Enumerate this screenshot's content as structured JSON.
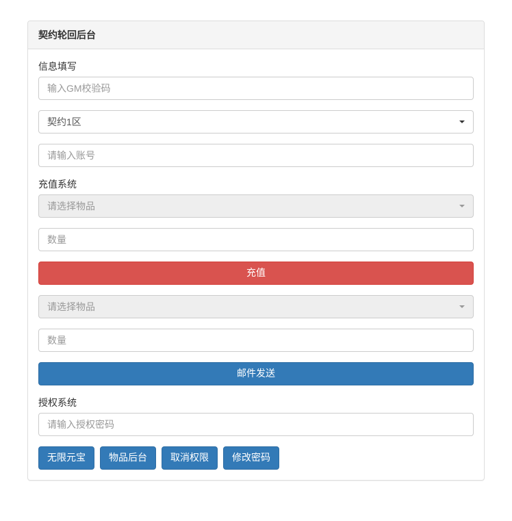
{
  "panel": {
    "title": "契约轮回后台"
  },
  "info_section": {
    "label": "信息填写",
    "gm_code_placeholder": "输入GM校验码",
    "server_selected": "契约1区",
    "account_placeholder": "请输入账号"
  },
  "recharge_section": {
    "label": "充值系统",
    "item_select_placeholder": "请选择物品",
    "quantity_placeholder": "数量",
    "recharge_button": "充值",
    "item_select_placeholder_2": "请选择物品",
    "quantity_placeholder_2": "数量",
    "mail_button": "邮件发送"
  },
  "auth_section": {
    "label": "授权系统",
    "auth_password_placeholder": "请输入授权密码"
  },
  "actions": {
    "unlimited_gold": "无限元宝",
    "item_admin": "物品后台",
    "revoke_permission": "取消权限",
    "change_password": "修改密码"
  }
}
